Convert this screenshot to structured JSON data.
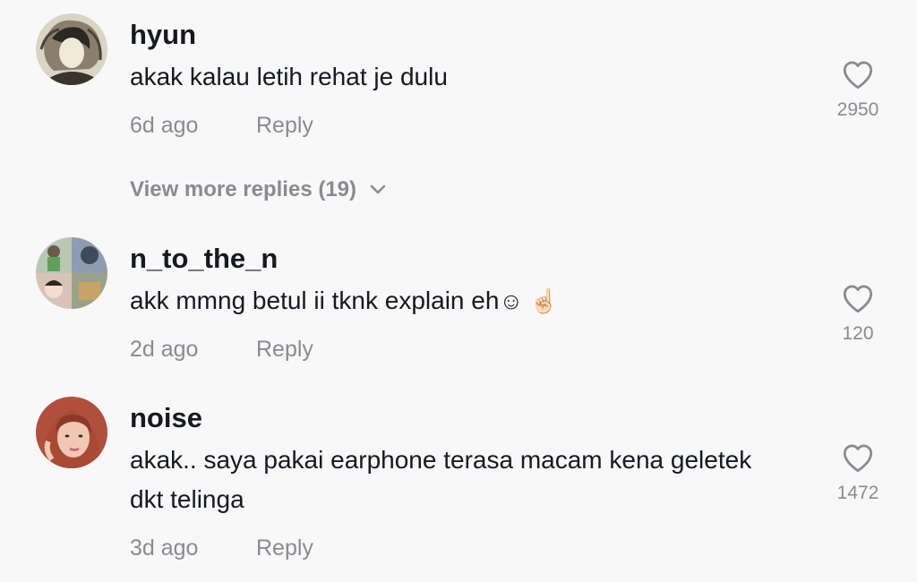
{
  "comments": [
    {
      "username": "hyun",
      "text": "akak kalau letih rehat je dulu",
      "time": "6d ago",
      "reply_label": "Reply",
      "likes": "2950",
      "view_more": "View more replies (19)"
    },
    {
      "username": "n_to_the_n",
      "text": "akk mmng betul ii tknk explain eh",
      "emoji": "☺ ☝🏻",
      "time": "2d ago",
      "reply_label": "Reply",
      "likes": "120"
    },
    {
      "username": "noise",
      "text": "akak.. saya pakai earphone terasa macam kena geletek dkt telinga",
      "time": "3d ago",
      "reply_label": "Reply",
      "likes": "1472"
    }
  ],
  "icons": {
    "like": "heart-outline-icon",
    "expand": "chevron-down-icon"
  },
  "colors": {
    "background": "#f8f8f8",
    "primary_text": "#161823",
    "secondary_text": "#8a8b91"
  }
}
